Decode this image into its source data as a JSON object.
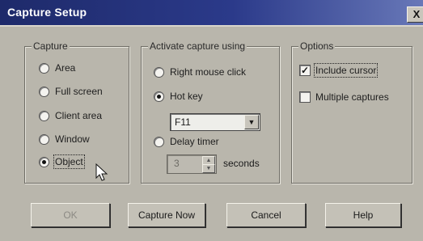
{
  "window": {
    "title": "Capture Setup",
    "close_label": "X"
  },
  "capture": {
    "label": "Capture",
    "options": [
      {
        "label": "Area",
        "selected": false
      },
      {
        "label": "Full screen",
        "selected": false
      },
      {
        "label": "Client area",
        "selected": false
      },
      {
        "label": "Window",
        "selected": false
      },
      {
        "label": "Object",
        "selected": true
      }
    ]
  },
  "activate": {
    "label": "Activate capture using",
    "right_mouse_click": "Right mouse click",
    "hot_key": "Hot key",
    "hot_key_value": "F11",
    "delay_timer": "Delay timer",
    "delay_value": "3",
    "seconds_label": "seconds",
    "selected": "hot_key"
  },
  "options": {
    "label": "Options",
    "include_cursor": {
      "label": "Include cursor",
      "checked": true
    },
    "multiple_captures": {
      "label": "Multiple captures",
      "checked": false
    }
  },
  "buttons": {
    "ok": "OK",
    "capture_now": "Capture Now",
    "cancel": "Cancel",
    "help": "Help"
  },
  "icons": {
    "close": "close-icon",
    "dropdown": "chevron-down-icon",
    "spin_up": "spin-up-icon",
    "spin_down": "spin-down-icon",
    "checkmark": "checkmark-icon",
    "cursor": "mouse-pointer-icon"
  }
}
